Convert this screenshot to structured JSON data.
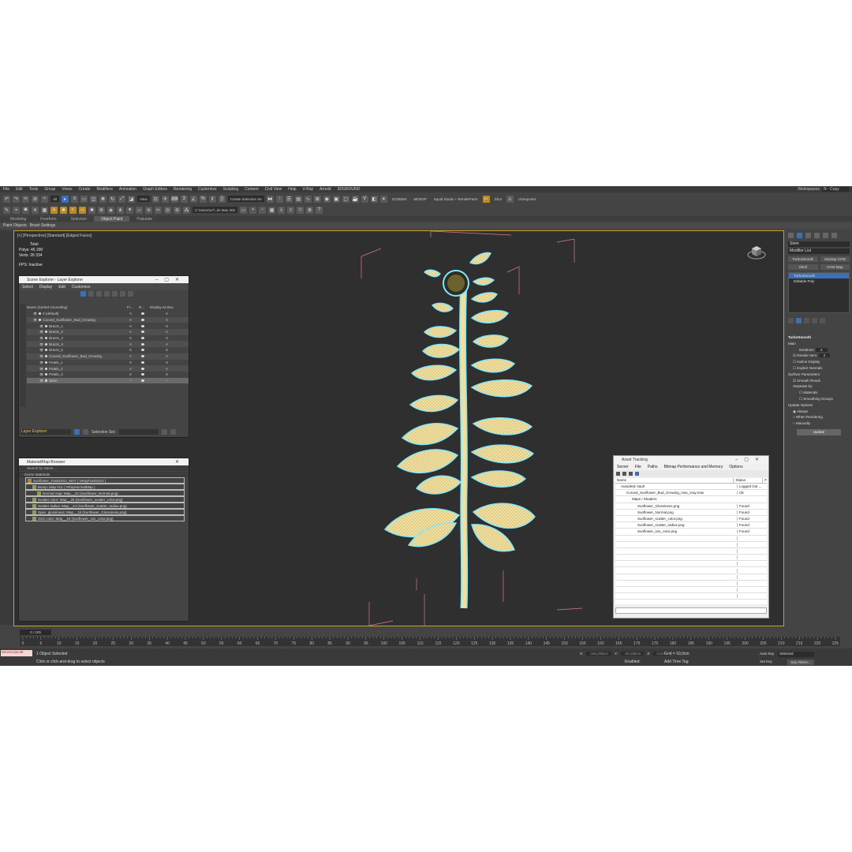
{
  "menu": [
    "File",
    "Edit",
    "Tools",
    "Group",
    "Views",
    "Create",
    "Modifiers",
    "Animation",
    "Graph Editors",
    "Rendering",
    "Customize",
    "Scripting",
    "Content",
    "Civil View",
    "Help",
    "V-Ray",
    "Arnold",
    "3DGROUND"
  ],
  "workspace": {
    "label": "Workspaces:",
    "value": "N - Copy"
  },
  "toolbar": {
    "filter": "All",
    "view": "View",
    "selection_set": "Create Selection Se",
    "screen": "SCREEN",
    "mouse": "MOESP",
    "render_preset": "Squid Studio + RenderFarm",
    "shot": "Shot",
    "unwrap": "UVexporter",
    "path": "C:\\Users\\LF\\..ds Max 202"
  },
  "ribbon": {
    "tabs": [
      "Modeling",
      "Freeform",
      "Selection",
      "Object Paint",
      "Populate"
    ],
    "active": "Object Paint"
  },
  "subribbon": [
    "Paint Objects",
    "Brush Settings"
  ],
  "viewport": {
    "label": "[+] [Perspective] [Standard] [Edged Faces]",
    "stats_title": "Total",
    "polys_label": "Polys:",
    "polys": "45 290",
    "verts_label": "Verts:",
    "verts": "26 334",
    "fps_label": "FPS:",
    "fps": "Inactive"
  },
  "scene_explorer": {
    "title": "Scene Explorer - Layer Explorer",
    "menu": [
      "Select",
      "Display",
      "Edit",
      "Customize"
    ],
    "columns": {
      "name": "Name (Sorted Ascending)",
      "c1": "Fr...",
      "c2": "R...",
      "c3": "Display as Box"
    },
    "rows": [
      {
        "label": "0 (default)",
        "indent": 1
      },
      {
        "label": "Curved_Sunflower_Bud_Growing",
        "indent": 1
      },
      {
        "label": "Bracts_1",
        "indent": 2
      },
      {
        "label": "Bracts_2",
        "indent": 2
      },
      {
        "label": "Bracts_3",
        "indent": 2
      },
      {
        "label": "Bracts_4",
        "indent": 2
      },
      {
        "label": "Bracts_5",
        "indent": 2
      },
      {
        "label": "Curved_Sunflower_Bud_Growing",
        "indent": 2
      },
      {
        "label": "Petals_1",
        "indent": 2
      },
      {
        "label": "Petals_2",
        "indent": 2
      },
      {
        "label": "Petals_3",
        "indent": 2
      },
      {
        "label": "Stem",
        "indent": 2
      }
    ],
    "footer_layer": "Layer Explorer",
    "footer_selset": "Selection Set:"
  },
  "material_browser": {
    "title": "Material/Map Browser",
    "search": "Search by Name ...",
    "section": "- Scene Materials",
    "rows": [
      "Sunflower_FastSSS2_MAT ( VRayFastSSS2 )",
      "Bump: Map #11 ( VRayNormalMap )",
      "Normal map: Map__22 (Sunflower_Normal.png)",
      "Scatter color: Map__25 (Sunflower_scatter_color.png)",
      "Scatter radius: Map__24 (Sunflower_scatter_radius.png)",
      "Spec. glossiness: Map__18 (Sunflower_Glossiness.png)",
      "SSS color: Map__19 (Sunflower_sss_color.png)"
    ]
  },
  "asset_tracking": {
    "title": "Asset Tracking",
    "menu": [
      "Server",
      "File",
      "Paths",
      "Bitmap Performance and Memory",
      "Options"
    ],
    "col_name": "Name",
    "col_status": "Status",
    "col_extra": "F",
    "rows": [
      {
        "name": "Autodesk Vault",
        "status": "Logged Out ...",
        "indent": 1
      },
      {
        "name": "Curved_Sunflower_Bud_Growing_max_vray.max",
        "status": "Ok",
        "indent": 2
      },
      {
        "name": "Maps / Shaders",
        "status": "",
        "indent": 3
      },
      {
        "name": "Sunflower_Glossiness.png",
        "status": "Found",
        "indent": 4
      },
      {
        "name": "Sunflower_Normal.png",
        "status": "Found",
        "indent": 4
      },
      {
        "name": "Sunflower_scatter_color.png",
        "status": "Found",
        "indent": 4
      },
      {
        "name": "Sunflower_scatter_radius.png",
        "status": "Found",
        "indent": 4
      },
      {
        "name": "Sunflower_sss_color.png",
        "status": "Found",
        "indent": 4
      }
    ]
  },
  "command_panel": {
    "object_name": "Stem",
    "modifier_list": "Modifier List",
    "buttons1": [
      "TurboSmooth",
      "Unwrap UVW"
    ],
    "buttons2": [
      "Shell",
      "UVW Map"
    ],
    "stack": [
      "TurboSmooth",
      "Editable Poly"
    ],
    "rollout": {
      "title": "TurboSmooth",
      "main": "Main",
      "iterations": "Iterations:",
      "iterations_val": "2",
      "render_iters": "Render Iters:",
      "render_iters_val": "2",
      "isoline": "Isoline Display",
      "explicit": "Explicit Normals",
      "surface": "Surface Parameters",
      "smooth_result": "Smooth Result",
      "separate_by": "Separate by:",
      "materials": "Materials",
      "smoothing_groups": "Smoothing Groups",
      "update_options": "Update Options",
      "always": "Always",
      "when_rendering": "When Rendering",
      "manually": "Manually",
      "update": "Update"
    }
  },
  "timeline": {
    "slider": "0 / 225",
    "ticks": [
      "0",
      "5",
      "10",
      "15",
      "20",
      "25",
      "30",
      "35",
      "40",
      "45",
      "50",
      "55",
      "60",
      "65",
      "70",
      "75",
      "80",
      "85",
      "90",
      "95",
      "100",
      "105",
      "110",
      "115",
      "120",
      "125",
      "130",
      "135",
      "140",
      "145",
      "150",
      "155",
      "160",
      "165",
      "170",
      "175",
      "180",
      "185",
      "190",
      "195",
      "200",
      "205",
      "210",
      "215",
      "220",
      "225"
    ]
  },
  "status": {
    "maxscript": "MAXScript Mi:",
    "selected": "1 Object Selected",
    "hint": "Click or click-and-drag to select objects",
    "x": "X:",
    "xv": "-164,295cm",
    "y": "Y:",
    "yv": "-20,186cm",
    "z": "Z:",
    "zv": "0,0cm",
    "grid": "Grid = 10,0cm",
    "enabled": "Enabled:",
    "add_tag": "Add Time Tag",
    "autokey": "Auto Key",
    "setkey": "Set Key",
    "selected_set": "Selected",
    "key_filters": "Key Filters...",
    "frame": "0"
  },
  "colors": {
    "viewport_border": "#c9a227",
    "wire_outline": "#7fe8ff",
    "leaf": "#e8d89a"
  }
}
